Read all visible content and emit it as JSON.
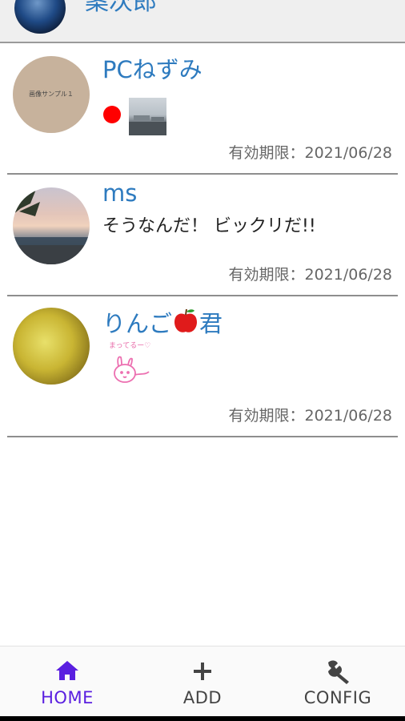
{
  "header": {
    "title": "案次郎"
  },
  "posts": [
    {
      "name": "PCねずみ",
      "avatar_caption": "画像サンプル１",
      "message": "",
      "attachments": [
        "red-dot",
        "photo-thumbnail"
      ],
      "expiry": "有効期限：2021/06/28"
    },
    {
      "name": "ms",
      "message": "そうなんだ！ ビックリだ!!",
      "attachments": [],
      "expiry": "有効期限：2021/06/28"
    },
    {
      "name": "りんご",
      "name_emoji": "apple-icon",
      "name_suffix": "君",
      "message": "",
      "attachments": [
        "sticker"
      ],
      "sticker_text": "まってるー♡",
      "expiry": "有効期限：2021/06/28"
    }
  ],
  "tabbar": {
    "tabs": [
      {
        "label": "HOME",
        "icon": "home-icon",
        "active": true
      },
      {
        "label": "ADD",
        "icon": "plus-icon",
        "active": false
      },
      {
        "label": "CONFIG",
        "icon": "wrench-icon",
        "active": false
      }
    ]
  },
  "colors": {
    "accent": "#2e7bbf",
    "active_tab": "#5a1fe0",
    "red_dot": "#ff0000"
  }
}
